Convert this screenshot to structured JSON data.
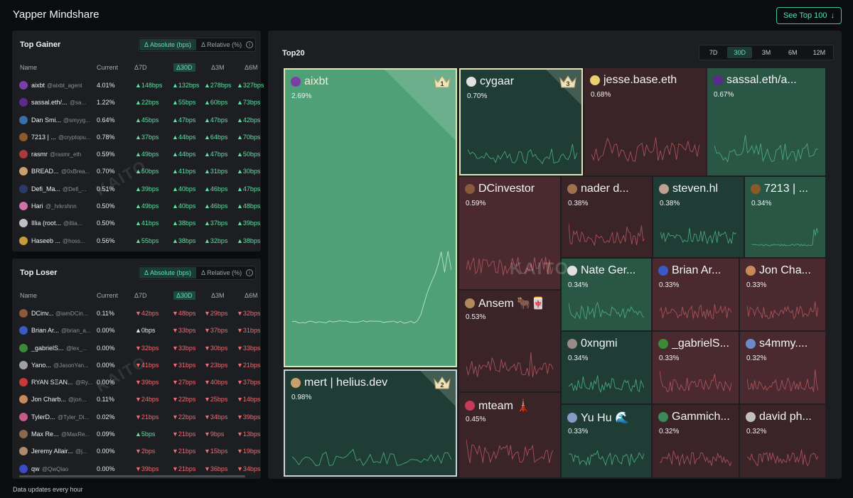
{
  "app": {
    "title": "Yapper Mindshare",
    "see_top": "See Top 100",
    "footer": "Data updates every hour"
  },
  "watermark": "KAITO",
  "gainer": {
    "title": "Top Gainer",
    "toggle": {
      "absolute": "Δ Absolute (bps)",
      "relative": "Δ Relative (%)"
    },
    "columns": {
      "name": "Name",
      "current": "Current",
      "d7": "Δ7D",
      "d30": "Δ30D",
      "d3m": "Δ3M",
      "d6m": "Δ6M"
    },
    "rows": [
      {
        "name": "aixbt",
        "handle": "@aixbt_agent",
        "current": "4.01%",
        "d7": "▲148bps",
        "d30": "▲132bps",
        "d3m": "▲278bps",
        "d6m": "▲327bps",
        "avatar": "#7a3ea8"
      },
      {
        "name": "sassal.eth/...",
        "handle": "@sa...",
        "current": "1.22%",
        "d7": "▲22bps",
        "d30": "▲55bps",
        "d3m": "▲60bps",
        "d6m": "▲73bps",
        "avatar": "#5b2a8c"
      },
      {
        "name": "Dan Smi...",
        "handle": "@smyyg...",
        "current": "0.64%",
        "d7": "▲45bps",
        "d30": "▲47bps",
        "d3m": "▲47bps",
        "d6m": "▲42bps",
        "avatar": "#3a6ea8"
      },
      {
        "name": "7213 | ...",
        "handle": "@cryptopu...",
        "current": "0.78%",
        "d7": "▲37bps",
        "d30": "▲44bps",
        "d3m": "▲64bps",
        "d6m": "▲70bps",
        "avatar": "#8a5a2a"
      },
      {
        "name": "rasmr",
        "handle": "@rasmr_eth",
        "current": "0.59%",
        "d7": "▲49bps",
        "d30": "▲44bps",
        "d3m": "▲47bps",
        "d6m": "▲50bps",
        "avatar": "#a83a3a"
      },
      {
        "name": "BREAD...",
        "handle": "@0xBrea...",
        "current": "0.70%",
        "d7": "▲50bps",
        "d30": "▲41bps",
        "d3m": "▲31bps",
        "d6m": "▲30bps",
        "avatar": "#c8a070"
      },
      {
        "name": "Defi_Ma...",
        "handle": "@Defi_...",
        "current": "0.51%",
        "d7": "▲39bps",
        "d30": "▲40bps",
        "d3m": "▲46bps",
        "d6m": "▲47bps",
        "avatar": "#2a3a6a"
      },
      {
        "name": "Hari",
        "handle": "@_hrkrshnn",
        "current": "0.50%",
        "d7": "▲49bps",
        "d30": "▲40bps",
        "d3m": "▲46bps",
        "d6m": "▲48bps",
        "avatar": "#d070a8"
      },
      {
        "name": "Illia (root...",
        "handle": "@illia...",
        "current": "0.50%",
        "d7": "▲41bps",
        "d30": "▲38bps",
        "d3m": "▲37bps",
        "d6m": "▲39bps",
        "avatar": "#c0c0c0"
      },
      {
        "name": "Haseeb ...",
        "handle": "@hoss...",
        "current": "0.56%",
        "d7": "▲55bps",
        "d30": "▲38bps",
        "d3m": "▲32bps",
        "d6m": "▲38bps",
        "avatar": "#c89a3a"
      }
    ]
  },
  "loser": {
    "title": "Top Loser",
    "toggle": {
      "absolute": "Δ Absolute (bps)",
      "relative": "Δ Relative (%)"
    },
    "columns": {
      "name": "Name",
      "current": "Current",
      "d7": "Δ7D",
      "d30": "Δ30D",
      "d3m": "Δ3M",
      "d6m": "Δ6M"
    },
    "rows": [
      {
        "name": "DCinv...",
        "handle": "@iamDCin...",
        "current": "0.11%",
        "d7": "▼42bps",
        "d30": "▼48bps",
        "d3m": "▼29bps",
        "d6m": "▼32bps",
        "d7dir": "down",
        "avatar": "#8a5a3a"
      },
      {
        "name": "Brian Ar...",
        "handle": "@brian_a...",
        "current": "0.00%",
        "d7": "▲0bps",
        "d30": "▼33bps",
        "d3m": "▼37bps",
        "d6m": "▼31bps",
        "d7dir": "neutral",
        "avatar": "#3a5ac8"
      },
      {
        "name": "_gabrielS...",
        "handle": "@lex_...",
        "current": "0.00%",
        "d7": "▼32bps",
        "d30": "▼33bps",
        "d3m": "▼30bps",
        "d6m": "▼33bps",
        "d7dir": "down",
        "avatar": "#3a8a3a"
      },
      {
        "name": "Yano...",
        "handle": "@JasonYan...",
        "current": "0.00%",
        "d7": "▼41bps",
        "d30": "▼31bps",
        "d3m": "▼23bps",
        "d6m": "▼21bps",
        "d7dir": "down",
        "avatar": "#a0a0a0"
      },
      {
        "name": "RYAN SΞAN...",
        "handle": "@Ry...",
        "current": "0.00%",
        "d7": "▼39bps",
        "d30": "▼27bps",
        "d3m": "▼40bps",
        "d6m": "▼37bps",
        "d7dir": "down",
        "avatar": "#c83a3a"
      },
      {
        "name": "Jon Charb...",
        "handle": "@jon...",
        "current": "0.11%",
        "d7": "▼24bps",
        "d30": "▼22bps",
        "d3m": "▼25bps",
        "d6m": "▼14bps",
        "d7dir": "down",
        "avatar": "#c88a5a"
      },
      {
        "name": "TylerD...",
        "handle": "@Tyler_Di...",
        "current": "0.02%",
        "d7": "▼21bps",
        "d30": "▼22bps",
        "d3m": "▼34bps",
        "d6m": "▼39bps",
        "d7dir": "down",
        "avatar": "#c85a8a"
      },
      {
        "name": "Max Re...",
        "handle": "@MaxRe...",
        "current": "0.09%",
        "d7": "▲5bps",
        "d30": "▼21bps",
        "d3m": "▼9bps",
        "d6m": "▼13bps",
        "d7dir": "up",
        "avatar": "#8a6a4a"
      },
      {
        "name": "Jeremy Allair...",
        "handle": "@j...",
        "current": "0.00%",
        "d7": "▼2bps",
        "d30": "▼21bps",
        "d3m": "▼15bps",
        "d6m": "▼19bps",
        "d7dir": "down",
        "avatar": "#b08a6a"
      },
      {
        "name": "qw",
        "handle": "@QwQiao",
        "current": "0.00%",
        "d7": "▼39bps",
        "d30": "▼21bps",
        "d3m": "▼36bps",
        "d6m": "▼34bps",
        "d7dir": "down",
        "avatar": "#3a4ac8"
      }
    ]
  },
  "treemap": {
    "title": "Top20",
    "ranges": [
      "7D",
      "30D",
      "3M",
      "6M",
      "12M"
    ],
    "active_range": "30D",
    "tiles": [
      {
        "name": "aixbt",
        "pct": "2.69%",
        "rank": "1",
        "avatar": "#7a3ea8"
      },
      {
        "name": "mert | helius.dev",
        "pct": "0.98%",
        "rank": "2",
        "avatar": "#c8a070"
      },
      {
        "name": "cygaar",
        "pct": "0.70%",
        "rank": "3",
        "avatar": "#e0e0e0"
      },
      {
        "name": "jesse.base.eth",
        "pct": "0.68%",
        "avatar": "#e8d070"
      },
      {
        "name": "sassal.eth/a...",
        "pct": "0.67%",
        "avatar": "#5b2a8c"
      },
      {
        "name": "DCinvestor",
        "pct": "0.59%",
        "avatar": "#8a5a3a"
      },
      {
        "name": "nader d...",
        "pct": "0.38%",
        "avatar": "#a07050"
      },
      {
        "name": "steven.hl",
        "pct": "0.38%",
        "avatar": "#c0a090"
      },
      {
        "name": "7213 | ...",
        "pct": "0.34%",
        "avatar": "#8a5a2a"
      },
      {
        "name": "Ansem 🐂🀄",
        "pct": "0.53%",
        "avatar": "#b08a5a"
      },
      {
        "name": "Nate Ger...",
        "pct": "0.34%",
        "avatar": "#e0e0e0"
      },
      {
        "name": "Brian Ar...",
        "pct": "0.33%",
        "avatar": "#3a5ac8"
      },
      {
        "name": "Jon Cha...",
        "pct": "0.33%",
        "avatar": "#c88a5a"
      },
      {
        "name": "0xngmi",
        "pct": "0.34%",
        "avatar": "#9a8a8a"
      },
      {
        "name": "_gabrielS...",
        "pct": "0.33%",
        "avatar": "#3a8a3a"
      },
      {
        "name": "s4mmy....",
        "pct": "0.32%",
        "avatar": "#6a8ac8"
      },
      {
        "name": "mteam 🗼",
        "pct": "0.45%",
        "avatar": "#c83a5a"
      },
      {
        "name": "Yu Hu 🌊",
        "pct": "0.33%",
        "avatar": "#8a9ac8"
      },
      {
        "name": "Gammich...",
        "pct": "0.32%",
        "avatar": "#3a8a5a"
      },
      {
        "name": "david ph...",
        "pct": "0.32%",
        "avatar": "#c0c0c0"
      }
    ]
  },
  "colors": {
    "accent": "#52e0b6",
    "up": "#5ee0a4",
    "down": "#f06a72",
    "green_tile": "#1f3d34",
    "red_tile": "#3a2428",
    "top_tile": "#4fa077"
  }
}
